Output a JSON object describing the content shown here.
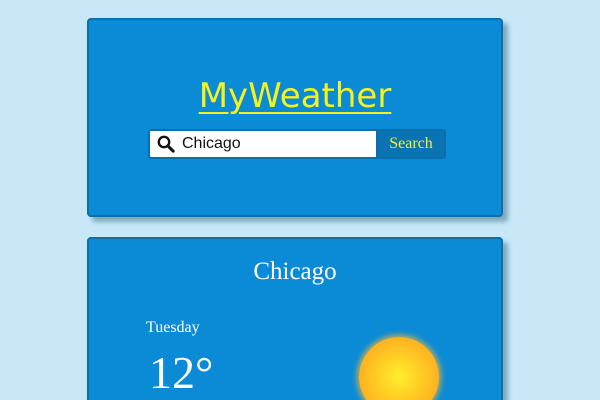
{
  "header": {
    "app_title": "MyWeather"
  },
  "search": {
    "value": "Chicago",
    "button_label": "Search"
  },
  "weather": {
    "city": "Chicago",
    "day": "Tuesday",
    "temperature": "12°",
    "condition_icon": "sun-icon"
  },
  "colors": {
    "background": "#c8e8f8",
    "card": "#0b8bd6",
    "accent_yellow": "#f5f21e",
    "button": "#0a73b3"
  }
}
